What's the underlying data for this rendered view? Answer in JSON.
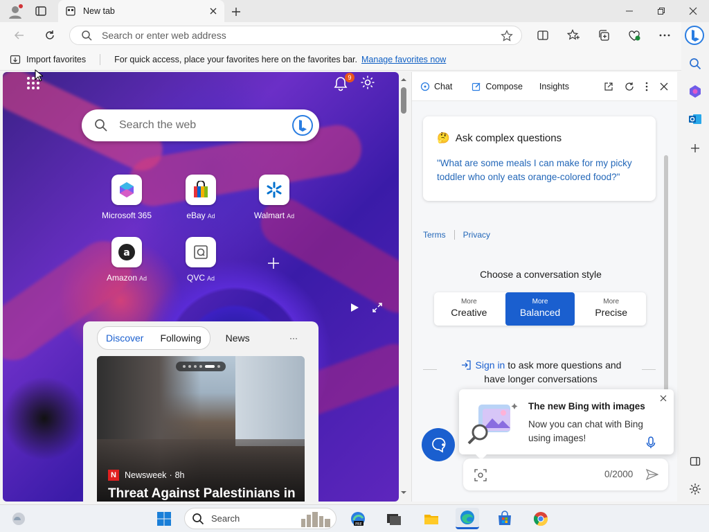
{
  "browser": {
    "tab_title": "New tab",
    "address_placeholder": "Search or enter web address"
  },
  "favorites_bar": {
    "import_label": "Import favorites",
    "hint": "For quick access, place your favorites here on the favorites bar.",
    "manage_link": "Manage favorites now"
  },
  "newtab": {
    "notification_count": "9",
    "search_placeholder": "Search the web",
    "tiles": [
      {
        "label": "Microsoft 365",
        "ad": ""
      },
      {
        "label": "eBay",
        "ad": "Ad"
      },
      {
        "label": "Walmart",
        "ad": "Ad"
      },
      {
        "label": "Amazon",
        "ad": "Ad"
      },
      {
        "label": "QVC",
        "ad": "Ad"
      }
    ],
    "feed": {
      "tabs": [
        "Discover",
        "Following",
        "News"
      ],
      "more": "···",
      "source": "Newsweek",
      "age": "8h",
      "headline": "Threat Against Palestinians in"
    }
  },
  "sidebar": {
    "tabs": [
      "Chat",
      "Compose",
      "Insights"
    ],
    "card": {
      "emoji": "🤔",
      "title": "Ask complex questions",
      "example": "\"What are some meals I can make for my picky toddler who only eats orange-colored food?\""
    },
    "links": {
      "terms": "Terms",
      "privacy": "Privacy"
    },
    "style_heading": "Choose a conversation style",
    "styles": [
      {
        "small": "More",
        "label": "Creative",
        "active": false
      },
      {
        "small": "More",
        "label": "Balanced",
        "active": true
      },
      {
        "small": "More",
        "label": "Precise",
        "active": false
      }
    ],
    "signin_link": "Sign in",
    "signin_rest1": "to ask more questions and",
    "signin_rest2": "have longer conversations",
    "popup": {
      "title": "The new Bing with images",
      "body": "Now you can chat with Bing using images!"
    },
    "char_count": "0/2000"
  },
  "taskbar": {
    "search_placeholder": "Search"
  },
  "colors": {
    "accent": "#1a5fcf",
    "link": "#0f5fc4",
    "badge": "#e8541c"
  }
}
